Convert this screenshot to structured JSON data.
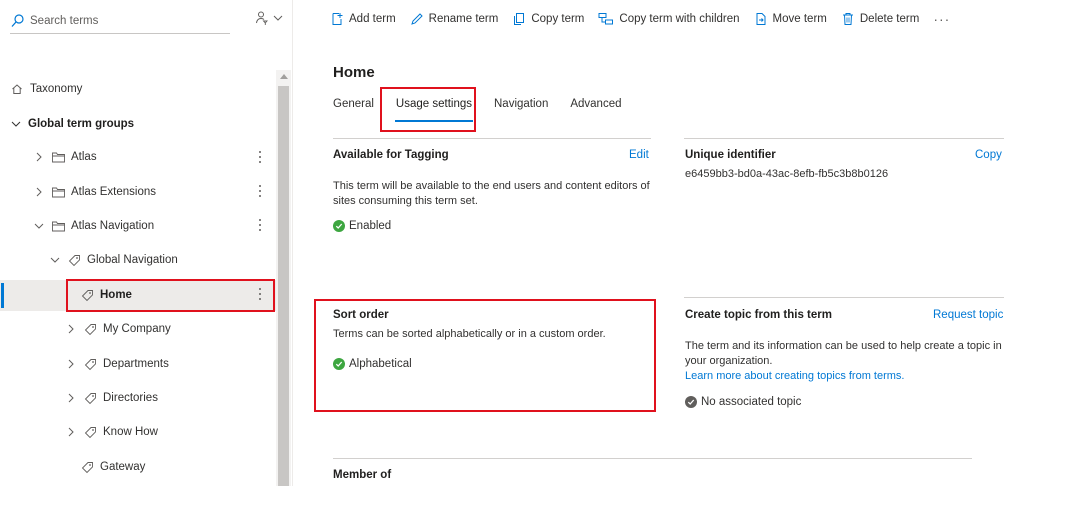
{
  "search": {
    "placeholder": "Search terms"
  },
  "colors": {
    "accent": "#0078d4",
    "highlight": "#e0111d",
    "success": "#3da640"
  },
  "tree": {
    "taxonomy": "Taxonomy",
    "global_term_groups": "Global term groups",
    "items": [
      {
        "label": "Atlas"
      },
      {
        "label": "Atlas Extensions"
      },
      {
        "label": "Atlas Navigation"
      },
      {
        "label": "Global Navigation"
      },
      {
        "label": "Home"
      },
      {
        "label": "My Company"
      },
      {
        "label": "Departments"
      },
      {
        "label": "Directories"
      },
      {
        "label": "Know How"
      },
      {
        "label": "Gateway"
      }
    ]
  },
  "toolbar": {
    "add_term": "Add term",
    "rename_term": "Rename term",
    "copy_term": "Copy term",
    "copy_with_children": "Copy term with children",
    "move_term": "Move term",
    "delete_term": "Delete term",
    "more": "···"
  },
  "main": {
    "title": "Home",
    "tabs": [
      "General",
      "Usage settings",
      "Navigation",
      "Advanced"
    ],
    "tagging": {
      "title": "Available for Tagging",
      "edit": "Edit",
      "description": "This term will be available to the end users and content editors of sites consuming this term set.",
      "status": "Enabled"
    },
    "identifier": {
      "title": "Unique identifier",
      "copy": "Copy",
      "value": "e6459bb3-bd0a-43ac-8efb-fb5c3b8b0126"
    },
    "sort": {
      "title": "Sort order",
      "description": "Terms can be sorted alphabetically or in a custom order.",
      "status": "Alphabetical"
    },
    "topic": {
      "title": "Create topic from this term",
      "request": "Request topic",
      "description": "The term and its information can be used to help create a topic in your organization.",
      "learn_more": "Learn more about creating topics from terms.",
      "status": "No associated topic"
    },
    "member_of": {
      "title": "Member of"
    }
  }
}
